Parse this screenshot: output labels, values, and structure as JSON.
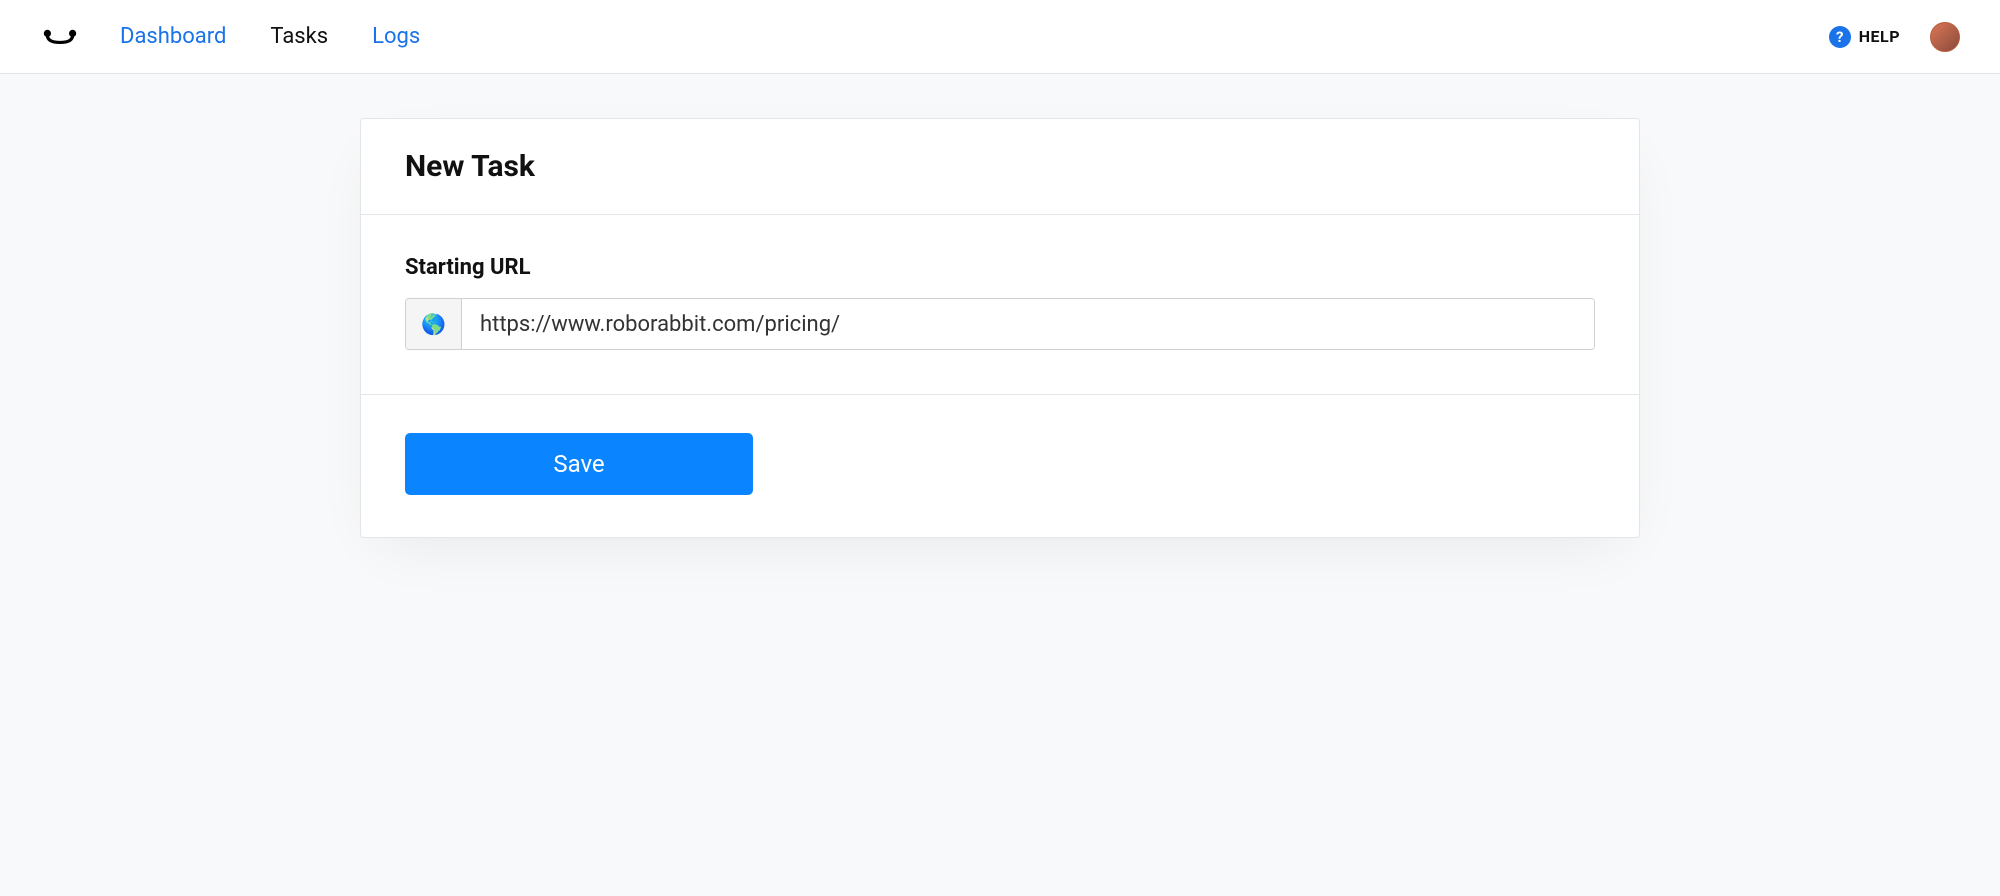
{
  "nav": {
    "dashboard": "Dashboard",
    "tasks": "Tasks",
    "logs": "Logs"
  },
  "topbar": {
    "help_label": "HELP"
  },
  "card": {
    "title": "New Task",
    "url_label": "Starting URL",
    "url_value": "https://www.roborabbit.com/pricing/",
    "save_label": "Save"
  }
}
